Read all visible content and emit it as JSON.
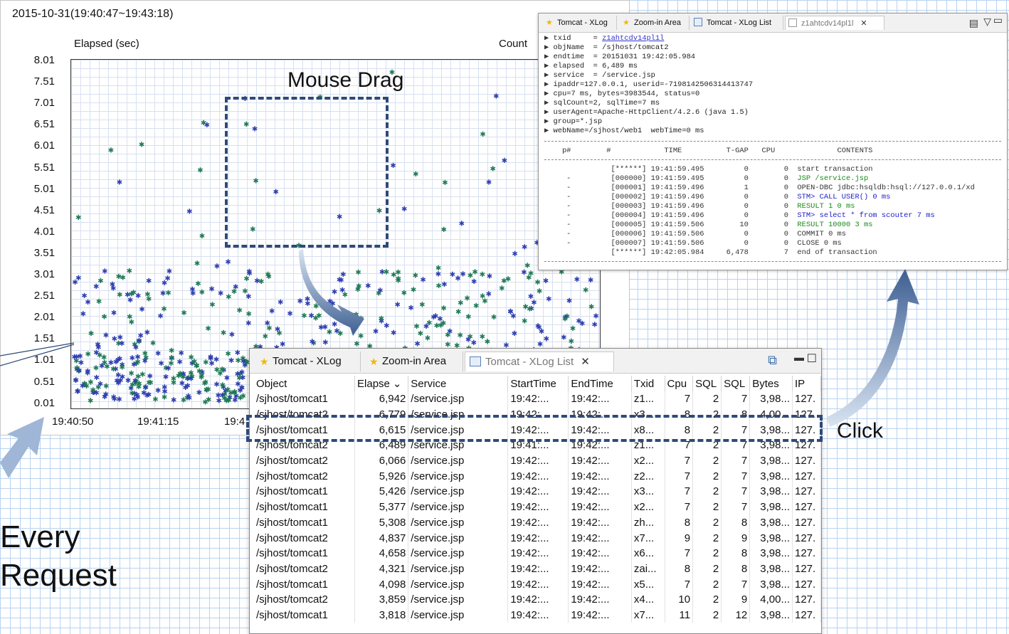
{
  "xlog_chart": {
    "range_title": "2015-10-31(19:40:47~19:43:18)",
    "ylabel": "Elapsed (sec)",
    "count_label": "Count",
    "yticks": [
      "8.01",
      "7.51",
      "7.01",
      "6.51",
      "6.01",
      "5.51",
      "5.01",
      "4.51",
      "4.01",
      "3.51",
      "3.01",
      "2.51",
      "2.01",
      "1.51",
      "1.01",
      "0.51",
      "0.01"
    ],
    "xticks": [
      "19:40:50",
      "19:41:15",
      "19:4"
    ],
    "colors": {
      "series_a": "#2f3fb0",
      "series_b": "#1f7a55",
      "grid": "#d7e0f0",
      "annotation": "#2e4a78"
    }
  },
  "annotations": {
    "drag_label": "Mouse Drag",
    "click_label": "Click",
    "every_line1": "Every",
    "every_line2": "Request"
  },
  "list_window": {
    "tabs": [
      {
        "label": "Tomcat - XLog",
        "icon": "star-icon"
      },
      {
        "label": "Zoom-in Area",
        "icon": "star-icon"
      },
      {
        "label": "Tomcat - XLog List",
        "icon": "list-icon"
      }
    ],
    "columns": [
      "Object",
      "Elapse",
      "Service",
      "StartTime",
      "EndTime",
      "Txid",
      "Cpu",
      "SQL",
      "SQL",
      "Bytes",
      "IP"
    ],
    "sort_indicator": "⌄",
    "rows": [
      [
        "/sjhost/tomcat1",
        "6,942",
        "/service.jsp",
        "19:42:...",
        "19:42:...",
        "z1...",
        "7",
        "2",
        "7",
        "3,98...",
        "127."
      ],
      [
        "/sjhost/tomcat2",
        "6,779",
        "/service.jsp",
        "19:42:...",
        "19:42:...",
        "x3...",
        "8",
        "2",
        "8",
        "4,00...",
        "127."
      ],
      [
        "/sjhost/tomcat1",
        "6,615",
        "/service.jsp",
        "19:42:...",
        "19:42:...",
        "x8...",
        "8",
        "2",
        "7",
        "3,98...",
        "127."
      ],
      [
        "/sjhost/tomcat2",
        "6,489",
        "/service.jsp",
        "19:41:...",
        "19:42:...",
        "z1...",
        "7",
        "2",
        "7",
        "3,98...",
        "127."
      ],
      [
        "/sjhost/tomcat2",
        "6,066",
        "/service.jsp",
        "19:42:...",
        "19:42:...",
        "x2...",
        "7",
        "2",
        "7",
        "3,98...",
        "127."
      ],
      [
        "/sjhost/tomcat2",
        "5,926",
        "/service.jsp",
        "19:42:...",
        "19:42:...",
        "z2...",
        "7",
        "2",
        "7",
        "3,98...",
        "127."
      ],
      [
        "/sjhost/tomcat1",
        "5,426",
        "/service.jsp",
        "19:42:...",
        "19:42:...",
        "x3...",
        "7",
        "2",
        "7",
        "3,98...",
        "127."
      ],
      [
        "/sjhost/tomcat1",
        "5,377",
        "/service.jsp",
        "19:42:...",
        "19:42:...",
        "x2...",
        "7",
        "2",
        "7",
        "3,98...",
        "127."
      ],
      [
        "/sjhost/tomcat1",
        "5,308",
        "/service.jsp",
        "19:42:...",
        "19:42:...",
        "zh...",
        "8",
        "2",
        "8",
        "3,98...",
        "127."
      ],
      [
        "/sjhost/tomcat2",
        "4,837",
        "/service.jsp",
        "19:42:...",
        "19:42:...",
        "x7...",
        "9",
        "2",
        "9",
        "3,98...",
        "127."
      ],
      [
        "/sjhost/tomcat1",
        "4,658",
        "/service.jsp",
        "19:42:...",
        "19:42:...",
        "x6...",
        "7",
        "2",
        "8",
        "3,98...",
        "127."
      ],
      [
        "/sjhost/tomcat2",
        "4,321",
        "/service.jsp",
        "19:42:...",
        "19:42:...",
        "zai...",
        "8",
        "2",
        "8",
        "3,98...",
        "127."
      ],
      [
        "/sjhost/tomcat1",
        "4,098",
        "/service.jsp",
        "19:42:...",
        "19:42:...",
        "x5...",
        "7",
        "2",
        "7",
        "3,98...",
        "127."
      ],
      [
        "/sjhost/tomcat2",
        "3,859",
        "/service.jsp",
        "19:42:...",
        "19:42:...",
        "x4...",
        "10",
        "2",
        "9",
        "4,00...",
        "127."
      ],
      [
        "/sjhost/tomcat1",
        "3,818",
        "/service.jsp",
        "19:42:...",
        "19:42:...",
        "x7...",
        "11",
        "2",
        "12",
        "3,98...",
        "127."
      ]
    ]
  },
  "detail_window": {
    "tabs": [
      {
        "label": "Tomcat - XLog",
        "icon": "star-icon"
      },
      {
        "label": "Zoom-in Area",
        "icon": "star-icon"
      },
      {
        "label": "Tomcat - XLog List",
        "icon": "list-icon"
      },
      {
        "label": "z1ahtcdv14pl1l",
        "icon": "doc-icon"
      }
    ],
    "fields": [
      {
        "key": "txid     = ",
        "value": "z1ahtcdv14pl1l",
        "link": true
      },
      {
        "key": "objName  = ",
        "value": "/sjhost/tomcat2"
      },
      {
        "key": "endtime  = ",
        "value": "20151031 19:42:05.984"
      },
      {
        "key": "elapsed  = ",
        "value": "6,489 ms"
      },
      {
        "key": "service  = ",
        "value": "/service.jsp"
      },
      {
        "key": "",
        "value": "ipaddr=127.0.0.1, userid=-7198142506314413747"
      },
      {
        "key": "",
        "value": "cpu=7 ms, bytes=3983544, status=0"
      },
      {
        "key": "",
        "value": "sqlCount=2, sqlTime=7 ms"
      },
      {
        "key": "",
        "value": "userAgent=Apache-HttpClient/4.2.6 (java 1.5)"
      },
      {
        "key": "",
        "value": "group=*.jsp"
      },
      {
        "key": "",
        "value": "webName=/sjhost/web1  webTime=0 ms"
      }
    ],
    "profile_header": "    p#        #            TIME          T-GAP   CPU              CONTENTS",
    "profile_rows": [
      {
        "prefix": "               [******] 19:41:59.495         0        0  ",
        "content": "start transaction",
        "color": ""
      },
      {
        "prefix": "     -         [000000] 19:41:59.495         0        0  ",
        "content": "JSP /service.jsp",
        "color": "green"
      },
      {
        "prefix": "     -         [000001] 19:41:59.496         1        0  ",
        "content": "OPEN-DBC jdbc:hsqldb:hsql://127.0.0.1/xd",
        "color": ""
      },
      {
        "prefix": "     -         [000002] 19:41:59.496         0        0  ",
        "content": "STM> CALL USER() 0 ms",
        "color": "blue"
      },
      {
        "prefix": "     -         [000003] 19:41:59.496         0        0  ",
        "content": "RESULT 1 0 ms",
        "color": "green"
      },
      {
        "prefix": "     -         [000004] 19:41:59.496         0        0  ",
        "content": "STM> select * from scouter 7 ms",
        "color": "blue"
      },
      {
        "prefix": "     -         [000005] 19:41:59.506        10        0  ",
        "content": "RESULT 10000 3 ms",
        "color": "green"
      },
      {
        "prefix": "     -         [000006] 19:41:59.506         0        0  ",
        "content": "COMMIT 0 ms",
        "color": ""
      },
      {
        "prefix": "     -         [000007] 19:41:59.506         0        0  ",
        "content": "CLOSE 0 ms",
        "color": ""
      },
      {
        "prefix": "               [******] 19:42:05.984     6,478        7  ",
        "content": "end of transaction",
        "color": ""
      }
    ]
  }
}
